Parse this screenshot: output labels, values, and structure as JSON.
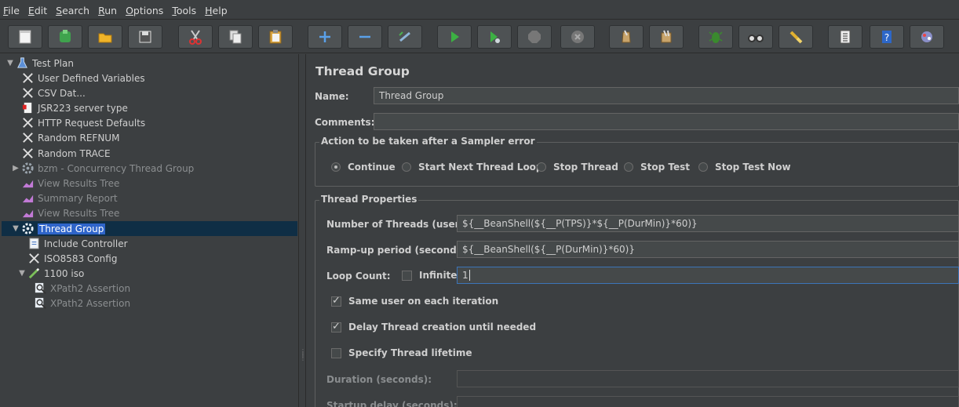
{
  "menu": [
    {
      "label": "File",
      "mnemonic": "F",
      "rest": "ile"
    },
    {
      "label": "Edit",
      "mnemonic": "E",
      "rest": "dit"
    },
    {
      "label": "Search",
      "mnemonic": "S",
      "rest": "earch"
    },
    {
      "label": "Run",
      "mnemonic": "R",
      "rest": "un"
    },
    {
      "label": "Options",
      "mnemonic": "O",
      "rest": "ptions"
    },
    {
      "label": "Tools",
      "mnemonic": "T",
      "rest": "ools"
    },
    {
      "label": "Help",
      "mnemonic": "H",
      "rest": "elp"
    }
  ],
  "toolbar": {
    "icons": [
      "new-icon",
      "templates-icon",
      "open-icon",
      "save-icon",
      "cut-icon",
      "copy-icon",
      "paste-icon",
      "expand-icon",
      "collapse-icon",
      "toggle-icon",
      "start-icon",
      "start-no-pause-icon",
      "stop-icon",
      "shutdown-icon",
      "clear-icon",
      "clear-all-icon",
      "search-icon",
      "reset-search-icon",
      "function-helper-icon",
      "help-icon",
      "remote-icon"
    ]
  },
  "tree": {
    "nodes": [
      {
        "label": "Test Plan",
        "toggle": "▼",
        "icon": "flask-icon"
      },
      {
        "label": "User Defined Variables",
        "icon": "wrench-icon"
      },
      {
        "label": "CSV Dat...",
        "icon": "wrench-icon"
      },
      {
        "label": "JSR223 server type",
        "icon": "script-icon"
      },
      {
        "label": "HTTP Request Defaults",
        "icon": "wrench-icon"
      },
      {
        "label": "Random REFNUM",
        "icon": "wrench-icon"
      },
      {
        "label": "Random TRACE",
        "icon": "wrench-icon"
      },
      {
        "label": "bzm - Concurrency Thread Group",
        "toggle": "▶",
        "icon": "gear-icon"
      },
      {
        "label": "View Results Tree",
        "icon": "chart-icon"
      },
      {
        "label": "Summary Report",
        "icon": "chart-icon"
      },
      {
        "label": "View Results Tree",
        "icon": "chart-icon"
      },
      {
        "label": "Thread Group",
        "toggle": "▼",
        "icon": "gear-icon"
      },
      {
        "label": "Include Controller",
        "icon": "doc-icon"
      },
      {
        "label": "ISO8583 Config",
        "icon": "wrench-icon"
      },
      {
        "label": "1100 iso",
        "toggle": "▼",
        "icon": "pen-icon"
      },
      {
        "label": "XPath2 Assertion",
        "icon": "magnifier-icon"
      },
      {
        "label": "XPath2 Assertion",
        "icon": "magnifier-icon"
      }
    ]
  },
  "panel": {
    "title": "Thread Group",
    "name_label": "Name:",
    "name_value": "Thread Group",
    "comments_label": "Comments:",
    "comments_value": "",
    "action_legend": "Action to be taken after a Sampler error",
    "actions": [
      {
        "label": "Continue",
        "selected": true
      },
      {
        "label": "Start Next Thread Loop",
        "selected": false
      },
      {
        "label": "Stop Thread",
        "selected": false
      },
      {
        "label": "Stop Test",
        "selected": false
      },
      {
        "label": "Stop Test Now",
        "selected": false
      }
    ],
    "props_legend": "Thread Properties",
    "threads_label": "Number of Threads (users):",
    "threads_value": "${__BeanShell(${__P(TPS)}*${__P(DurMin)}*60)}",
    "rampup_label": "Ramp-up period (seconds):",
    "rampup_value": "${__BeanShell(${__P(DurMin)}*60)}",
    "loop_label": "Loop Count:",
    "infinite_label": "Infinite",
    "infinite_checked": false,
    "loop_value": "1",
    "same_user_label": "Same user on each iteration",
    "same_user_checked": true,
    "delay_label": "Delay Thread creation until needed",
    "delay_checked": true,
    "lifetime_label": "Specify Thread lifetime",
    "lifetime_checked": false,
    "duration_label": "Duration (seconds):",
    "duration_value": "",
    "startup_label": "Startup delay (seconds):",
    "startup_value": ""
  },
  "colors": {
    "background": "#3c3f41",
    "selection": "#2f65ca",
    "field": "#45494a",
    "focus_border": "#3c74b8"
  }
}
